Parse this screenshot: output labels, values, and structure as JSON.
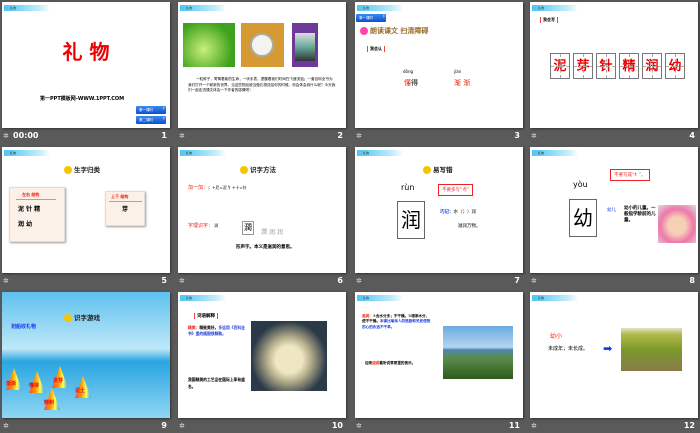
{
  "header_label": "礼物",
  "slides": [
    {
      "number": "1",
      "time": "00:00",
      "title": "礼 物",
      "site": "第一PPT模板网-WWW.1PPT.COM",
      "buttons": [
        "第一课时",
        "第二课时"
      ]
    },
    {
      "number": "2",
      "paragraph": "一粒种子，寄寓着新的生命；一块手表，提醒着我们时间在飞速流逝；一套百科全书为我们打开一个崭新的世界。当这些物品被当做礼物送给你的时候，你会体会到什么呢？今天我们一起走进课文体会一下作者的感情吧！"
    },
    {
      "number": "3",
      "button": "第一课时",
      "heading": "朗读课文 扫清障碍",
      "label": "我会认",
      "words": [
        {
          "pinyin": "dǒng",
          "hl": "懂",
          "rest": "得"
        },
        {
          "pinyin": "jiàn",
          "hl": "渐 渐",
          "rest": ""
        }
      ]
    },
    {
      "number": "4",
      "label": "我会写",
      "chars": [
        "泥",
        "芽",
        "针",
        "精",
        "润",
        "幼"
      ]
    },
    {
      "number": "5",
      "heading": "生字归类",
      "cards": [
        {
          "title": "左右  结构",
          "lines": [
            "泥  针  精",
            "润  幼"
          ]
        },
        {
          "title": "上下  结构",
          "lines": [
            "芽"
          ]
        }
      ]
    },
    {
      "number": "6",
      "heading": "识字方法",
      "add_label": "加一加：",
      "add_text": "氵+尼=泥     钅+十=针",
      "li_label": "字理识字：",
      "li_char": "润",
      "evolution": [
        "潤",
        "潤",
        "润",
        "润"
      ],
      "note": "形声字。本义是滋润的意思。"
    },
    {
      "number": "7",
      "heading": "易写错",
      "pinyin": "rùn",
      "char": "润",
      "warning": "不要多写“点”",
      "mem_label": "巧记：",
      "mem_line1": "水（氵）润",
      "mem_line2": "滋润万物。"
    },
    {
      "number": "8",
      "pinyin": "yòu",
      "char": "幼",
      "warning": "不要写成“纟”。",
      "word": "幼儿",
      "definition": "幼小的儿童。一般指学龄前的儿童。"
    },
    {
      "number": "9",
      "heading": "识字游戏",
      "game": "划船收礼物",
      "sails": [
        "渐渐",
        "懂得",
        "发芽",
        "泥土",
        "精制"
      ]
    },
    {
      "number": "10",
      "heading": "词语解释",
      "term": "精美：",
      "definition": "精致美好。",
      "extra": "多运用《百科全书》里的插图很精致。",
      "example": "我国精美的工艺品在国际上享有盛名。"
    },
    {
      "number": "11",
      "term": "滋润：",
      "definition": "①含水分多；不干燥。②增添水分，使不干燥。",
      "extra": "本课比喻亲人的鼓励和关爱使我的心田永远不干旱。",
      "example_pre": "迎来",
      "example_hl": "滋润",
      "example_post": "着听说草原里的音乐。"
    },
    {
      "number": "12",
      "word": "幼小",
      "definition": "未成年；未长成。"
    }
  ]
}
